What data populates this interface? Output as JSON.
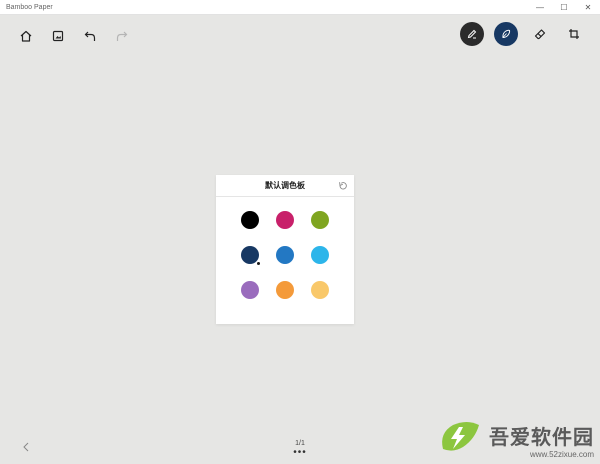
{
  "window": {
    "title": "Bamboo Paper",
    "controls": [
      "—",
      "☐",
      "✕"
    ]
  },
  "toolbar_left": [
    {
      "name": "home-icon"
    },
    {
      "name": "image-icon"
    },
    {
      "name": "undo-icon"
    },
    {
      "name": "redo-icon"
    }
  ],
  "toolbar_right": [
    {
      "name": "pen-tool-icon",
      "bg": "#2b2b2b"
    },
    {
      "name": "brush-tool-icon",
      "bg": "#173863"
    },
    {
      "name": "eraser-icon"
    },
    {
      "name": "crop-icon"
    }
  ],
  "palette": {
    "title": "默认调色板",
    "selected_index": 3,
    "colors": [
      "#000000",
      "#c8206a",
      "#7fa520",
      "#173863",
      "#2378c3",
      "#2cb5ea",
      "#9a6cbd",
      "#f49a3a",
      "#f9c86a"
    ]
  },
  "pager": {
    "text": "1/1",
    "dots": "•••"
  },
  "watermark": {
    "cn": "吾爱软件园",
    "url": "www.52zixue.com"
  }
}
